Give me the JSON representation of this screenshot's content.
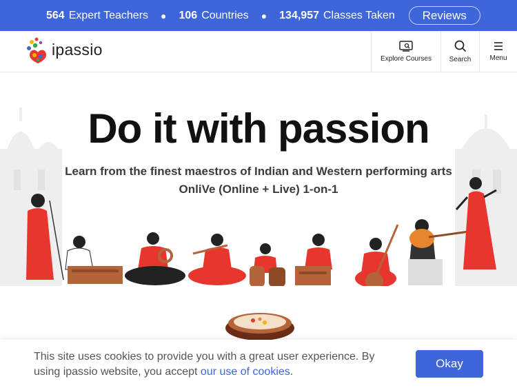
{
  "topbar": {
    "stats": [
      {
        "value": "564",
        "label": "Expert Teachers"
      },
      {
        "value": "106",
        "label": "Countries"
      },
      {
        "value": "134,957",
        "label": "Classes Taken"
      }
    ],
    "reviews_label": "Reviews"
  },
  "nav": {
    "brand": "ipassio",
    "explore_label": "Explore Courses",
    "search_label": "Search",
    "menu_label": "Menu"
  },
  "hero": {
    "title": "Do it with passion",
    "subtitle_line1": "Learn from the finest maestros of Indian and Western performing arts",
    "subtitle_line2": "OnliVe (Online + Live) 1-on-1"
  },
  "cookie": {
    "text": "This site uses cookies to provide you with a great user experience. By using ipassio website, you accept ",
    "link": "our use of cookies",
    "suffix": ".",
    "button": "Okay"
  },
  "colors": {
    "brand_blue": "#3e66da",
    "accent_red": "#e8362f"
  }
}
